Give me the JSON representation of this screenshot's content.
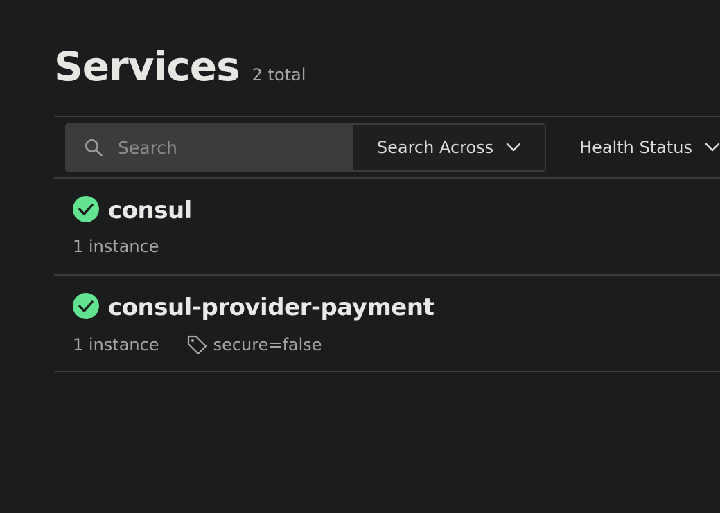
{
  "header": {
    "title": "Services",
    "total": "2 total"
  },
  "toolbar": {
    "search_placeholder": "Search",
    "search_across_label": "Search Across",
    "health_status_label": "Health Status"
  },
  "colors": {
    "background": "#1b1c1e",
    "passing": "#63e28f"
  },
  "services": [
    {
      "name": "consul",
      "status": "passing",
      "status_icon": "check-circle-icon",
      "instances": "1 instance",
      "tags": []
    },
    {
      "name": "consul-provider-payment",
      "status": "passing",
      "status_icon": "check-circle-icon",
      "instances": "1 instance",
      "tags": [
        "secure=false"
      ]
    }
  ]
}
